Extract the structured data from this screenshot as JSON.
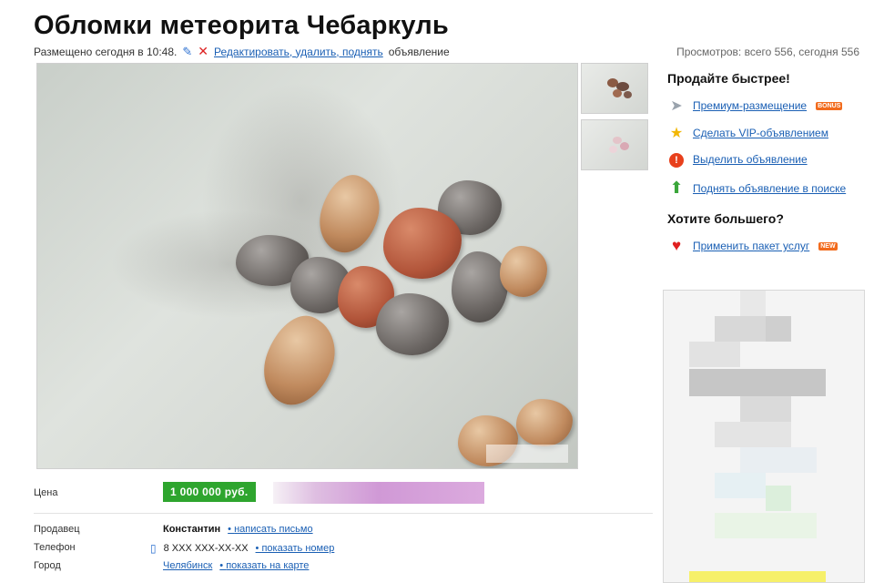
{
  "listing": {
    "title": "Обломки метеорита Чебаркуль",
    "posted": "Размещено сегодня в 10:48.",
    "edit_link": "Редактировать, удалить, поднять",
    "edit_suffix": "объявление"
  },
  "stats": {
    "views": "Просмотров: всего 556, сегодня 556"
  },
  "sidebar": {
    "promote_heading": "Продайте быстрее!",
    "promote_items": [
      {
        "label": "Премиум-размещение",
        "icon": "paper-plane-icon",
        "badge": "BONUS"
      },
      {
        "label": "Сделать VIP-объявлением",
        "icon": "star-icon"
      },
      {
        "label": "Выделить объявление",
        "icon": "alert-icon"
      },
      {
        "label": "Поднять объявление в поиске",
        "icon": "up-arrow-icon"
      }
    ],
    "more_heading": "Хотите большего?",
    "more_items": [
      {
        "label": "Применить пакет услуг",
        "icon": "heart-icon",
        "badge": "NEW"
      }
    ]
  },
  "details": {
    "price_label": "Цена",
    "price_value": "1 000 000 руб.",
    "seller_label": "Продавец",
    "seller_name": "Константин",
    "seller_action": "написать письмо",
    "phone_label": "Телефон",
    "phone_value": "8 XXX XXX-XX-XX",
    "phone_action": "показать номер",
    "city_label": "Город",
    "city_value": "Челябинск",
    "city_action": "показать на карте"
  },
  "colors": {
    "link": "#1a5fb4",
    "price_badge": "#2ea52e",
    "badge": "#f26b1d"
  }
}
